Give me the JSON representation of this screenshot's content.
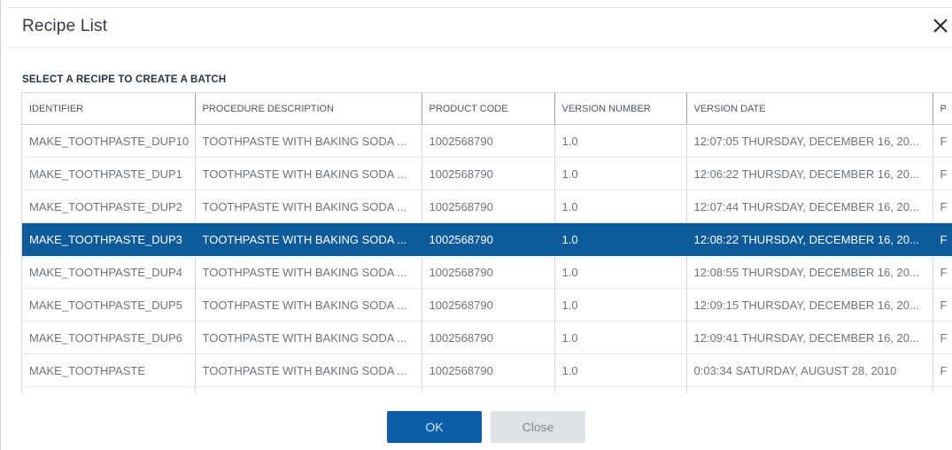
{
  "dialog": {
    "title": "Recipe List",
    "subtitle": "SELECT A RECIPE TO CREATE A BATCH"
  },
  "table": {
    "headers": [
      "IDENTIFIER",
      "PROCEDURE DESCRIPTION",
      "PRODUCT CODE",
      "VERSION NUMBER",
      "VERSION DATE",
      "P"
    ],
    "rows": [
      [
        "MAKE_TOOTHPASTE_DUP10",
        "TOOTHPASTE WITH BAKING SODA ...",
        "1002568790",
        "1.0",
        "12:07:05 THURSDAY, DECEMBER 16, 20...",
        "F"
      ],
      [
        "MAKE_TOOTHPASTE_DUP1",
        "TOOTHPASTE WITH BAKING SODA ...",
        "1002568790",
        "1.0",
        "12:06:22 THURSDAY, DECEMBER 16, 20...",
        "F"
      ],
      [
        "MAKE_TOOTHPASTE_DUP2",
        "TOOTHPASTE WITH BAKING SODA ...",
        "1002568790",
        "1.0",
        "12:07:44 THURSDAY, DECEMBER 16, 20...",
        "F"
      ],
      [
        "MAKE_TOOTHPASTE_DUP3",
        "TOOTHPASTE WITH BAKING SODA ...",
        "1002568790",
        "1.0",
        "12:08:22 THURSDAY, DECEMBER 16, 20...",
        "F"
      ],
      [
        "MAKE_TOOTHPASTE_DUP4",
        "TOOTHPASTE WITH BAKING SODA ...",
        "1002568790",
        "1.0",
        "12:08:55 THURSDAY, DECEMBER 16, 20...",
        "F"
      ],
      [
        "MAKE_TOOTHPASTE_DUP5",
        "TOOTHPASTE WITH BAKING SODA ...",
        "1002568790",
        "1.0",
        "12:09:15 THURSDAY, DECEMBER 16, 20...",
        "F"
      ],
      [
        "MAKE_TOOTHPASTE_DUP6",
        "TOOTHPASTE WITH BAKING SODA ...",
        "1002568790",
        "1.0",
        "12:09:41 THURSDAY, DECEMBER 16, 20...",
        "F"
      ],
      [
        "MAKE_TOOTHPASTE",
        "TOOTHPASTE WITH BAKING SODA ...",
        "1002568790",
        "1.0",
        "0:03:34 SATURDAY, AUGUST 28, 2010",
        "F"
      ],
      [
        "",
        "",
        "",
        "",
        "",
        ""
      ]
    ],
    "selected_row_index": 3
  },
  "buttons": {
    "ok_label": "OK",
    "close_label": "Close"
  },
  "icons": {
    "close": "close-icon"
  },
  "colors": {
    "selection": "#0d5b9b",
    "primary_button": "#0a5fa8",
    "secondary_button": "#dfe3e6"
  }
}
